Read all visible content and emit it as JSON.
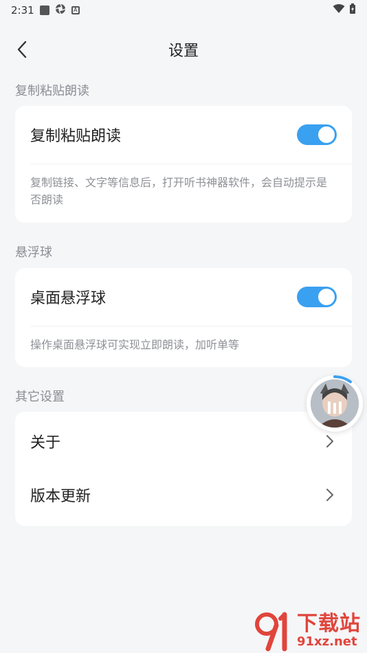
{
  "status_bar": {
    "time": "2:31",
    "a_badge": "A"
  },
  "header": {
    "title": "设置"
  },
  "sections": {
    "copy_read": {
      "label": "复制粘贴朗读",
      "row_label": "复制粘贴朗读",
      "toggle_on": true,
      "description": "复制链接、文字等信息后，打开听书神器软件，会自动提示是否朗读"
    },
    "float_ball": {
      "label": "悬浮球",
      "row_label": "桌面悬浮球",
      "toggle_on": true,
      "description": "操作桌面悬浮球可实现立即朗读，加听单等"
    },
    "other": {
      "label": "其它设置",
      "items": [
        {
          "label": "关于"
        },
        {
          "label": "版本更新"
        }
      ]
    }
  },
  "watermark": {
    "big": "下载站",
    "small": "91xz.net"
  },
  "colors": {
    "toggle_on": "#3aa0f0",
    "background": "#f5f6f8",
    "card": "#ffffff",
    "section_label": "#8a8d93",
    "watermark": "#e0453c"
  }
}
